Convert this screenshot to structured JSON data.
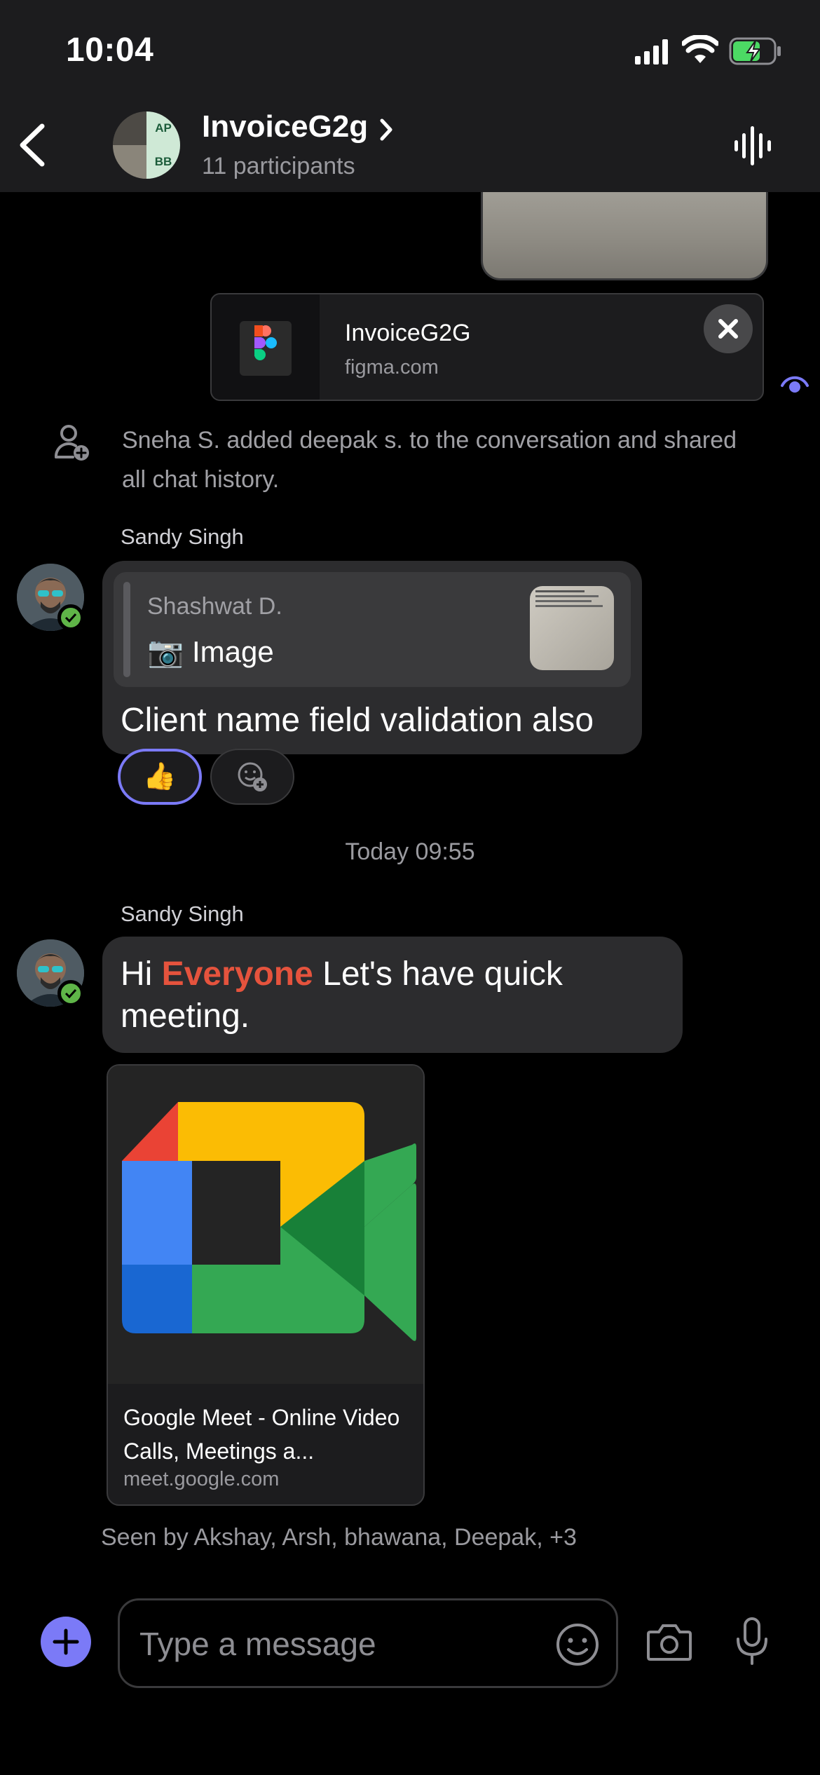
{
  "status_bar": {
    "time": "10:04"
  },
  "header": {
    "title": "InvoiceG2g",
    "subtitle": "11 participants",
    "avatar_initials": [
      "AP",
      "BB"
    ]
  },
  "link_preview": {
    "title": "InvoiceG2G",
    "domain": "figma.com"
  },
  "system_message": "Sneha S. added deepak s. to the conversation and shared all chat history.",
  "messages": [
    {
      "sender": "Sandy Singh",
      "quote": {
        "author": "Shashwat D.",
        "type_label": "📷 Image"
      },
      "text": "Client name field validation also",
      "reaction": "👍"
    },
    {
      "sender": "Sandy Singh",
      "text_before": "Hi ",
      "mention": "Everyone",
      "text_after": " Let's have quick meeting.",
      "link": {
        "title": "Google Meet - Online Video Calls, Meetings a...",
        "domain": "meet.google.com"
      }
    }
  ],
  "timestamp": "Today 09:55",
  "seen_by": "Seen by Akshay, Arsh, bhawana, Deepak, +3",
  "composer": {
    "placeholder": "Type a message"
  },
  "colors": {
    "accent": "#7b7af7",
    "mention": "#e5533d",
    "online": "#5fb548",
    "bubble": "#2c2c2e"
  }
}
